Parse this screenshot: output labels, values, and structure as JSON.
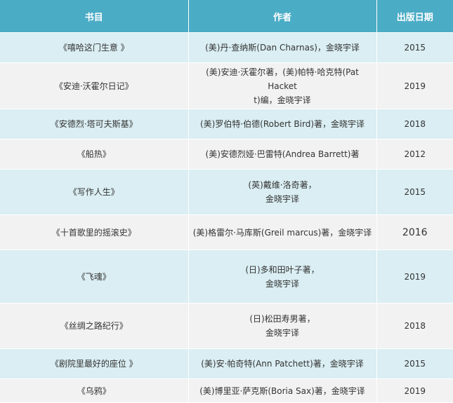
{
  "headers": [
    "书目",
    "作者",
    "出版日期"
  ],
  "rows": [
    {
      "title": "《嘻哈这门生意 》",
      "author": [
        "(美)丹·查纳斯(Dan Charnas)，金晓宇译"
      ],
      "year": "2015"
    },
    {
      "title": "《安迪·沃霍尔日记》",
      "author": [
        "(美)安迪·沃霍尔著，(美)帕特·哈克特(Pat Hacket",
        "t)编，金晓宇译"
      ],
      "year": "2019"
    },
    {
      "title": "《安德烈·塔可夫斯基》",
      "author": [
        "(美)罗伯特·伯德(Robert Bird)著，金晓宇译"
      ],
      "year": "2018"
    },
    {
      "title": "《船热》",
      "author": [
        "(美)安德烈娅·巴雷特(Andrea Barrett)著"
      ],
      "year": "2012"
    },
    {
      "title": "《写作人生》",
      "author": [
        "(英)戴维·洛奇著，",
        "金晓宇译"
      ],
      "year": "2015"
    },
    {
      "title": "《十首歌里的摇滚史》",
      "author": [
        "(美)格雷尔·马库斯(Greil marcus)著，金晓宇译"
      ],
      "year": "2016"
    },
    {
      "title": "《飞魂》",
      "author": [
        "(日)多和田叶子著，",
        "金晓宇译"
      ],
      "year": "2019"
    },
    {
      "title": "《丝绸之路纪行》",
      "author": [
        "(日)松田寿男著，",
        "金晓宇译"
      ],
      "year": "2018"
    },
    {
      "title": "《剧院里最好的座位 》",
      "author": [
        "(美)安·帕奇特(Ann Patchett)著，金晓宇译"
      ],
      "year": "2015"
    },
    {
      "title": "《乌鸦》",
      "author": [
        "(美)博里亚·萨克斯(Boria Sax)著，金晓宇译"
      ],
      "year": "2019"
    }
  ]
}
